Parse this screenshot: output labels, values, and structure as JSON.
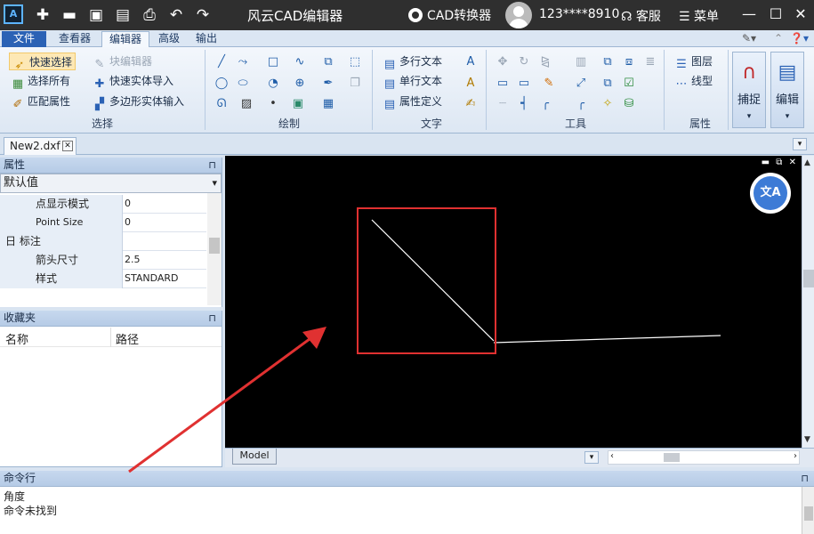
{
  "titlebar": {
    "title": "风云CAD编辑器",
    "converter_label": "CAD转换器",
    "user": "123****8910",
    "service_label": "客服",
    "menu_label": "菜单",
    "logo_text": "A"
  },
  "tabs": [
    "文件",
    "查看器",
    "编辑器",
    "高级",
    "输出"
  ],
  "active_tab": "编辑器",
  "ribbon": {
    "select_group": {
      "label": "选择",
      "quick_select": "快速选择",
      "select_all": "选择所有",
      "match_props": "匹配属性",
      "block_editor": "块编辑器",
      "quick_entity_import": "快速实体导入",
      "polygon_entity_input": "多边形实体输入"
    },
    "draw_group": {
      "label": "绘制"
    },
    "text_group": {
      "label": "文字",
      "mtext": "多行文本",
      "stext": "单行文本",
      "attdef": "属性定义"
    },
    "tools_group": {
      "label": "工具"
    },
    "props_group": {
      "label": "属性",
      "layers": "图层",
      "linetype": "线型"
    },
    "snap_button": "捕捉",
    "edit_button": "编辑"
  },
  "document_tab": "New2.dxf",
  "properties_panel": {
    "title": "属性",
    "selector_value": "默认值",
    "rows": [
      {
        "key": "点显示模式",
        "value": "0"
      },
      {
        "key": "Point Size",
        "value": "0"
      },
      {
        "key": "日 标注",
        "value": ""
      },
      {
        "key": "箭头尺寸",
        "value": "2.5"
      },
      {
        "key": "样式",
        "value": "STANDARD"
      }
    ]
  },
  "favorites_panel": {
    "title": "收藏夹",
    "col_name": "名称",
    "col_path": "路径"
  },
  "model_tab": "Model",
  "command_panel": {
    "title": "命令行",
    "lines": [
      "角度",
      "命令未找到"
    ]
  },
  "colors": {
    "titlebar": "#2f2f2f",
    "canvas": "#000000",
    "highlight_box": "#e03131",
    "arrow": "#e03131",
    "file_tab": "#2b62b5"
  },
  "icons": {
    "app_logo": "app-logo-icon",
    "translate": "translate-icon"
  }
}
